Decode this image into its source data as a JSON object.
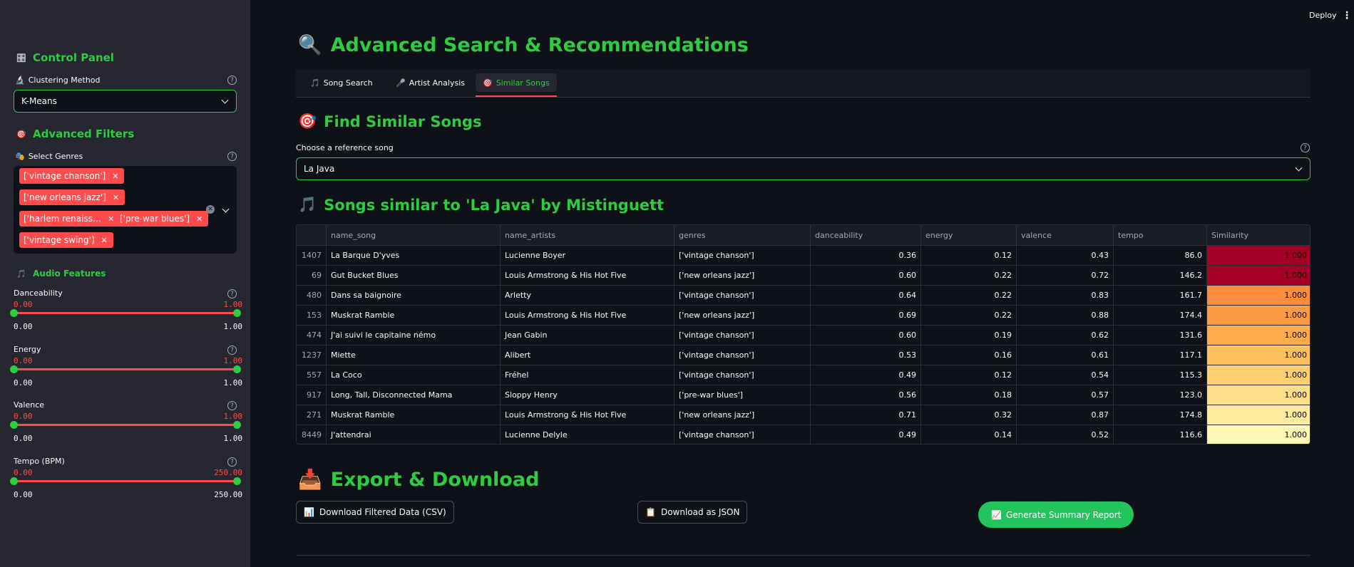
{
  "topbar": {
    "deploy_label": "Deploy",
    "menu_glyph": "⋮"
  },
  "sidebar": {
    "control_panel_title": "Control Panel",
    "control_panel_icon": "🎛️",
    "clustering_label": "Clustering Method",
    "clustering_icon": "🔬",
    "clustering_value": "K-Means",
    "filters_title": "Advanced Filters",
    "filters_icon": "🎯",
    "genres_label": "Select Genres",
    "genres_icon": "🎭",
    "genres_selected": [
      "['vintage chanson']",
      "['new orleans jazz']",
      "['harlem renaiss…",
      "['pre-war blues']",
      "['vintage swing']"
    ],
    "audio_title": "Audio Features",
    "audio_icon": "🎵",
    "sliders": [
      {
        "label": "Danceability",
        "min": "0.00",
        "max": "1.00",
        "low": "0.00",
        "high": "1.00"
      },
      {
        "label": "Energy",
        "min": "0.00",
        "max": "1.00",
        "low": "0.00",
        "high": "1.00"
      },
      {
        "label": "Valence",
        "min": "0.00",
        "max": "1.00",
        "low": "0.00",
        "high": "1.00"
      },
      {
        "label": "Tempo (BPM)",
        "min": "0.00",
        "max": "250.00",
        "low": "0.00",
        "high": "250.00"
      }
    ]
  },
  "main": {
    "title": "Advanced Search & Recommendations",
    "title_icon": "🔍",
    "tabs": [
      {
        "label": "Song Search",
        "icon": "🎵"
      },
      {
        "label": "Artist Analysis",
        "icon": "🎤"
      },
      {
        "label": "Similar Songs",
        "icon": "🎯"
      }
    ],
    "active_tab": "Similar Songs",
    "find_title": "Find Similar Songs",
    "find_icon": "🎯",
    "ref_label": "Choose a reference song",
    "ref_value": "La Java",
    "similar_title": "Songs similar to 'La Java' by Mistinguett",
    "similar_icon": "🎵",
    "table": {
      "columns": [
        "",
        "name_song",
        "name_artists",
        "genres",
        "danceability",
        "energy",
        "valence",
        "tempo",
        "Similarity"
      ],
      "rows": [
        {
          "idx": "1407",
          "song": "La Barque D'yves",
          "artist": "Lucienne Boyer",
          "genres": "['vintage chanson']",
          "dance": "0.36",
          "energy": "0.12",
          "valence": "0.43",
          "tempo": "86.0",
          "sim": "1.000",
          "color": "#a50026"
        },
        {
          "idx": "69",
          "song": "Gut Bucket Blues",
          "artist": "Louis Armstrong & His Hot Five",
          "genres": "['new orleans jazz']",
          "dance": "0.60",
          "energy": "0.22",
          "valence": "0.72",
          "tempo": "146.2",
          "sim": "1.000",
          "color": "#a50026"
        },
        {
          "idx": "480",
          "song": "Dans sa baignoire",
          "artist": "Arletty",
          "genres": "['vintage chanson']",
          "dance": "0.64",
          "energy": "0.22",
          "valence": "0.83",
          "tempo": "161.7",
          "sim": "1.000",
          "color": "#fb8d3c"
        },
        {
          "idx": "153",
          "song": "Muskrat Ramble",
          "artist": "Louis Armstrong & His Hot Five",
          "genres": "['new orleans jazz']",
          "dance": "0.69",
          "energy": "0.22",
          "valence": "0.88",
          "tempo": "174.4",
          "sim": "1.000",
          "color": "#fd9a44"
        },
        {
          "idx": "474",
          "song": "J'ai suivi le capitaine némo",
          "artist": "Jean Gabin",
          "genres": "['vintage chanson']",
          "dance": "0.60",
          "energy": "0.19",
          "valence": "0.62",
          "tempo": "131.6",
          "sim": "1.000",
          "color": "#fdab4b"
        },
        {
          "idx": "1237",
          "song": "Miette",
          "artist": "Alibert",
          "genres": "['vintage chanson']",
          "dance": "0.53",
          "energy": "0.16",
          "valence": "0.61",
          "tempo": "117.1",
          "sim": "1.000",
          "color": "#fec05c"
        },
        {
          "idx": "557",
          "song": "La Coco",
          "artist": "Fréhel",
          "genres": "['vintage chanson']",
          "dance": "0.49",
          "energy": "0.12",
          "valence": "0.54",
          "tempo": "115.3",
          "sim": "1.000",
          "color": "#fed072"
        },
        {
          "idx": "917",
          "song": "Long, Tall, Disconnected Mama",
          "artist": "Sloppy Henry",
          "genres": "['pre-war blues']",
          "dance": "0.56",
          "energy": "0.18",
          "valence": "0.57",
          "tempo": "123.0",
          "sim": "1.000",
          "color": "#fede88"
        },
        {
          "idx": "271",
          "song": "Muskrat Ramble",
          "artist": "Louis Armstrong & His Hot Five",
          "genres": "['new orleans jazz']",
          "dance": "0.71",
          "energy": "0.32",
          "valence": "0.87",
          "tempo": "174.8",
          "sim": "1.000",
          "color": "#ffeba0"
        },
        {
          "idx": "8449",
          "song": "J'attendrai",
          "artist": "Lucienne Delyle",
          "genres": "['vintage chanson']",
          "dance": "0.49",
          "energy": "0.14",
          "valence": "0.52",
          "tempo": "116.6",
          "sim": "1.000",
          "color": "#fff7b5"
        }
      ]
    },
    "export_title": "Export & Download",
    "export_icon": "📥",
    "buttons": {
      "csv": "Download Filtered Data (CSV)",
      "csv_icon": "📊",
      "json": "Download as JSON",
      "json_icon": "📋",
      "report": "Generate Summary Report",
      "report_icon": "📈"
    }
  },
  "colors": {
    "accent": "#2ecc40",
    "slider": "#ff4b4b",
    "tag": "#ff4b4b",
    "primary_button": "#21c45d"
  }
}
